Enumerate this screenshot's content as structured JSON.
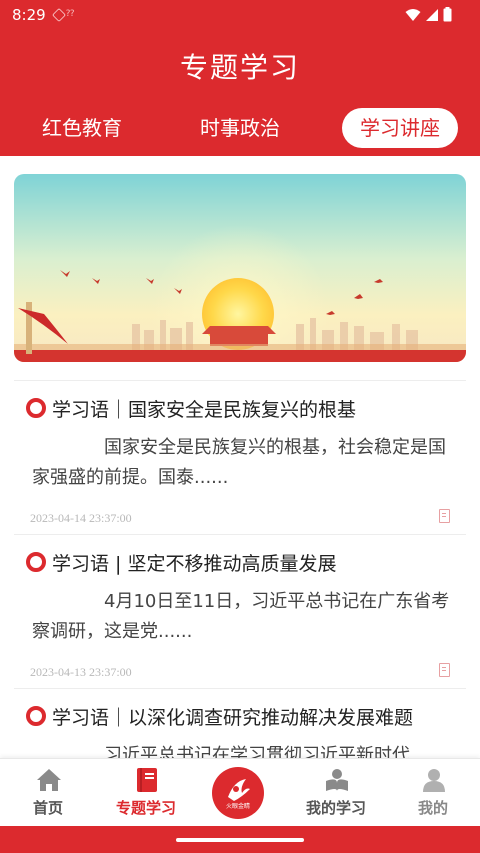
{
  "status_bar": {
    "time": "8:29"
  },
  "header": {
    "title": "专题学习"
  },
  "tabs": [
    {
      "label": "红色教育"
    },
    {
      "label": "时事政治"
    },
    {
      "label": "学习讲座",
      "selected": true
    }
  ],
  "articles": [
    {
      "title": "学习语｜国家安全是民族复兴的根基",
      "summary": "国家安全是民族复兴的根基，社会稳定是国家强盛的前提。国泰......",
      "date": "2023-04-14 23:37:00"
    },
    {
      "title": "学习语 | 坚定不移推动高质量发展",
      "summary": "4月10日至11日，习近平总书记在广东省考察调研，这是党......",
      "date": "2023-04-13 23:37:00"
    },
    {
      "title": "学习语｜以深化调查研究推动解决发展难题",
      "summary": "习近平总书记在学习贯彻习近平新时代"
    }
  ],
  "bottom_nav": {
    "items": [
      {
        "label": "首页",
        "icon": "home-icon"
      },
      {
        "label": "专题学习",
        "icon": "book-icon",
        "active": true
      },
      {
        "label": "火眼金睛",
        "icon": "center-logo-icon"
      },
      {
        "label": "我的学习",
        "icon": "reading-icon"
      },
      {
        "label": "我的",
        "icon": "user-icon"
      }
    ]
  },
  "colors": {
    "primary": "#dc2a2e",
    "background": "#ffffff",
    "date_text": "#b8b8b8"
  }
}
